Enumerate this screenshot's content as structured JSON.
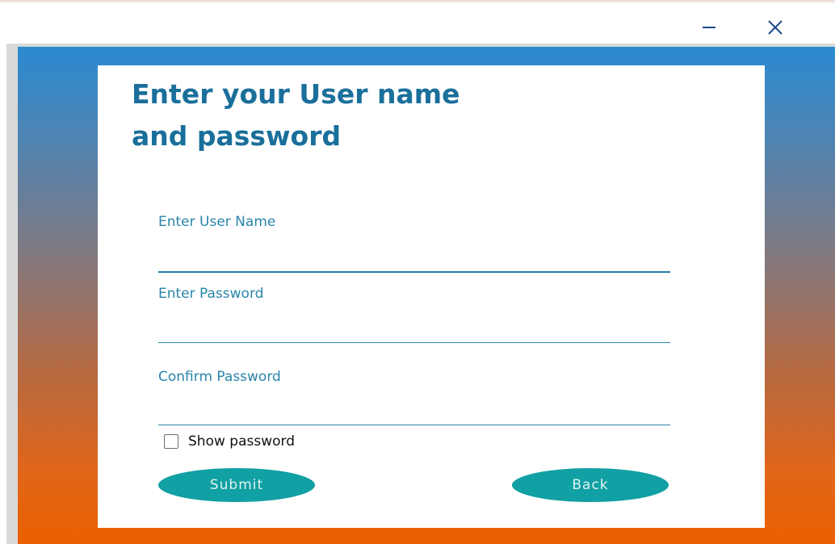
{
  "window": {
    "minimize_icon": "minimize-icon",
    "close_icon": "close-icon"
  },
  "colors": {
    "heading": "#1a6f9b",
    "label": "#2a86a8",
    "button": "#11a0a3",
    "gradient_top": "#2b8ad1",
    "gradient_bottom": "#ea6000"
  },
  "form": {
    "heading_line1": "Enter your User name",
    "heading_line2": "and password",
    "username_label": "Enter User Name",
    "username_value": "",
    "password_label": "Enter Password",
    "password_value": "",
    "confirm_label": "Confirm Password",
    "confirm_value": "",
    "show_password_label": "Show password",
    "show_password_checked": false,
    "submit_label": "Submit",
    "back_label": "Back"
  }
}
